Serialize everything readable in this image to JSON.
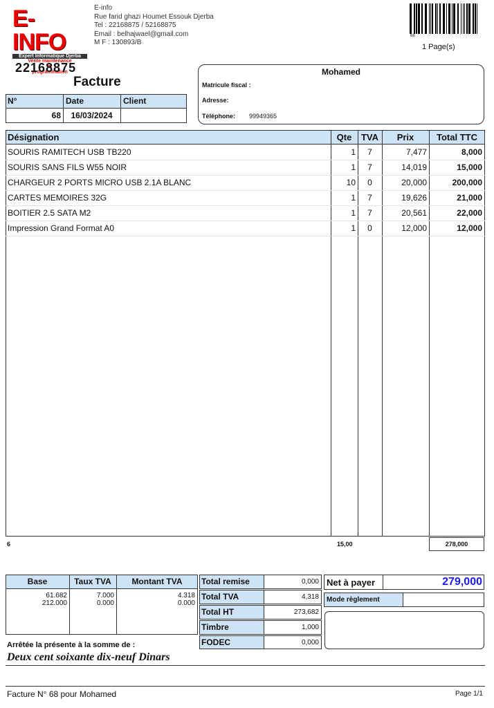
{
  "company": {
    "logo_text": "E-INFO",
    "logo_tagline": "Expert Informatique Djerba",
    "logo_sub": [
      "Vente maintenance",
      "et",
      "programmation"
    ],
    "phone_big": "22168875",
    "name": "E-info",
    "address": "Rue farid ghazi Houmet Essouk Djerba",
    "tel": "Tel : 22168875 / 52168875",
    "email": "Email : belhajwael@gmail.com",
    "mf": "M F : 130893/B"
  },
  "barcode": {
    "value": "68"
  },
  "pages": "1  Page(s)",
  "doc_title": "Facture",
  "info": {
    "headers": [
      "N°",
      "Date",
      "Client"
    ],
    "number": "68",
    "date": "16/03/2024",
    "client": ""
  },
  "client": {
    "name": "Mohamed",
    "matricule_label": "Matricule fiscal :",
    "adresse_label": "Adresse:",
    "telephone_label": "Tèléphone:",
    "telephone": "99949365"
  },
  "table": {
    "headers": [
      "Désignation",
      "Qte",
      "TVA",
      "Prix",
      "Total TTC"
    ],
    "rows": [
      [
        "SOURIS RAMITECH USB TB220",
        "1",
        "7",
        "7,477",
        "8,000"
      ],
      [
        "SOURIS SANS FILS W55 NOIR",
        "1",
        "7",
        "14,019",
        "15,000"
      ],
      [
        "CHARGEUR 2 PORTS MICRO USB 2.1A BLANC",
        "10",
        "0",
        "20,000",
        "200,000"
      ],
      [
        "CARTES MEMOIRES 32G",
        "1",
        "7",
        "19,626",
        "21,000"
      ],
      [
        "BOITIER 2.5 SATA M2",
        "1",
        "7",
        "20,561",
        "22,000"
      ],
      [
        "Impression Grand Format A0",
        "1",
        "0",
        "12,000",
        "12,000"
      ]
    ],
    "footer": {
      "count": "6",
      "qty": "15,00",
      "total": "278,000"
    }
  },
  "tva": {
    "headers": [
      "Base",
      "Taux TVA",
      "Montant TVA"
    ],
    "base": "61.682\n212.000",
    "taux": "7.000\n0.000",
    "montant": "4.318\n0.000"
  },
  "totals": [
    [
      "Total remise",
      "0,000"
    ],
    [
      "Total TVA",
      "4,318"
    ],
    [
      "Total HT",
      "273,682"
    ],
    [
      "Timbre",
      "1,000"
    ],
    [
      "FODEC",
      "0,000"
    ]
  ],
  "net": {
    "label": "Net à payer",
    "value": "279,000",
    "color": "#1a1aff"
  },
  "mode": {
    "label": "Mode règlement",
    "value": ""
  },
  "arrete": {
    "label": "Arrêtée la présente à la somme de :",
    "words": "Deux cent soixante dix-neuf Dinars"
  },
  "footer": {
    "left": "Facture N° 68 pour Mohamed",
    "right": "Page 1/1"
  }
}
